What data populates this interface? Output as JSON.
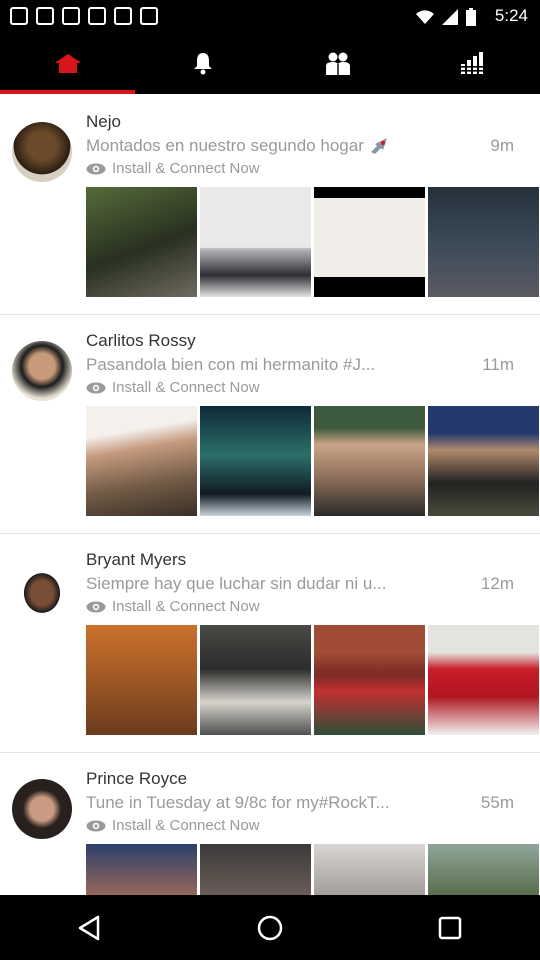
{
  "status_bar": {
    "time": "5:24"
  },
  "tabs": [
    {
      "icon": "home-icon",
      "active": true
    },
    {
      "icon": "bell-icon",
      "active": false
    },
    {
      "icon": "people-icon",
      "active": false
    },
    {
      "icon": "bar-chart-icon",
      "active": false
    }
  ],
  "accent_color": "#d9151c",
  "install_label": "Install & Connect Now",
  "feed": [
    {
      "name": "Nejo",
      "message": "Montados en nuestro segundo hogar",
      "time": "9m",
      "has_rocket_emoji": true
    },
    {
      "name": "Carlitos Rossy",
      "message": "Pasandola bien con mi hermanito #J...",
      "time": "11m"
    },
    {
      "name": "Bryant Myers",
      "message": "Siempre hay que luchar sin dudar ni u...",
      "time": "12m"
    },
    {
      "name": "Prince Royce",
      "message": "Tune in Tuesday at 9/8c for my#RockT...",
      "time": "55m"
    }
  ]
}
